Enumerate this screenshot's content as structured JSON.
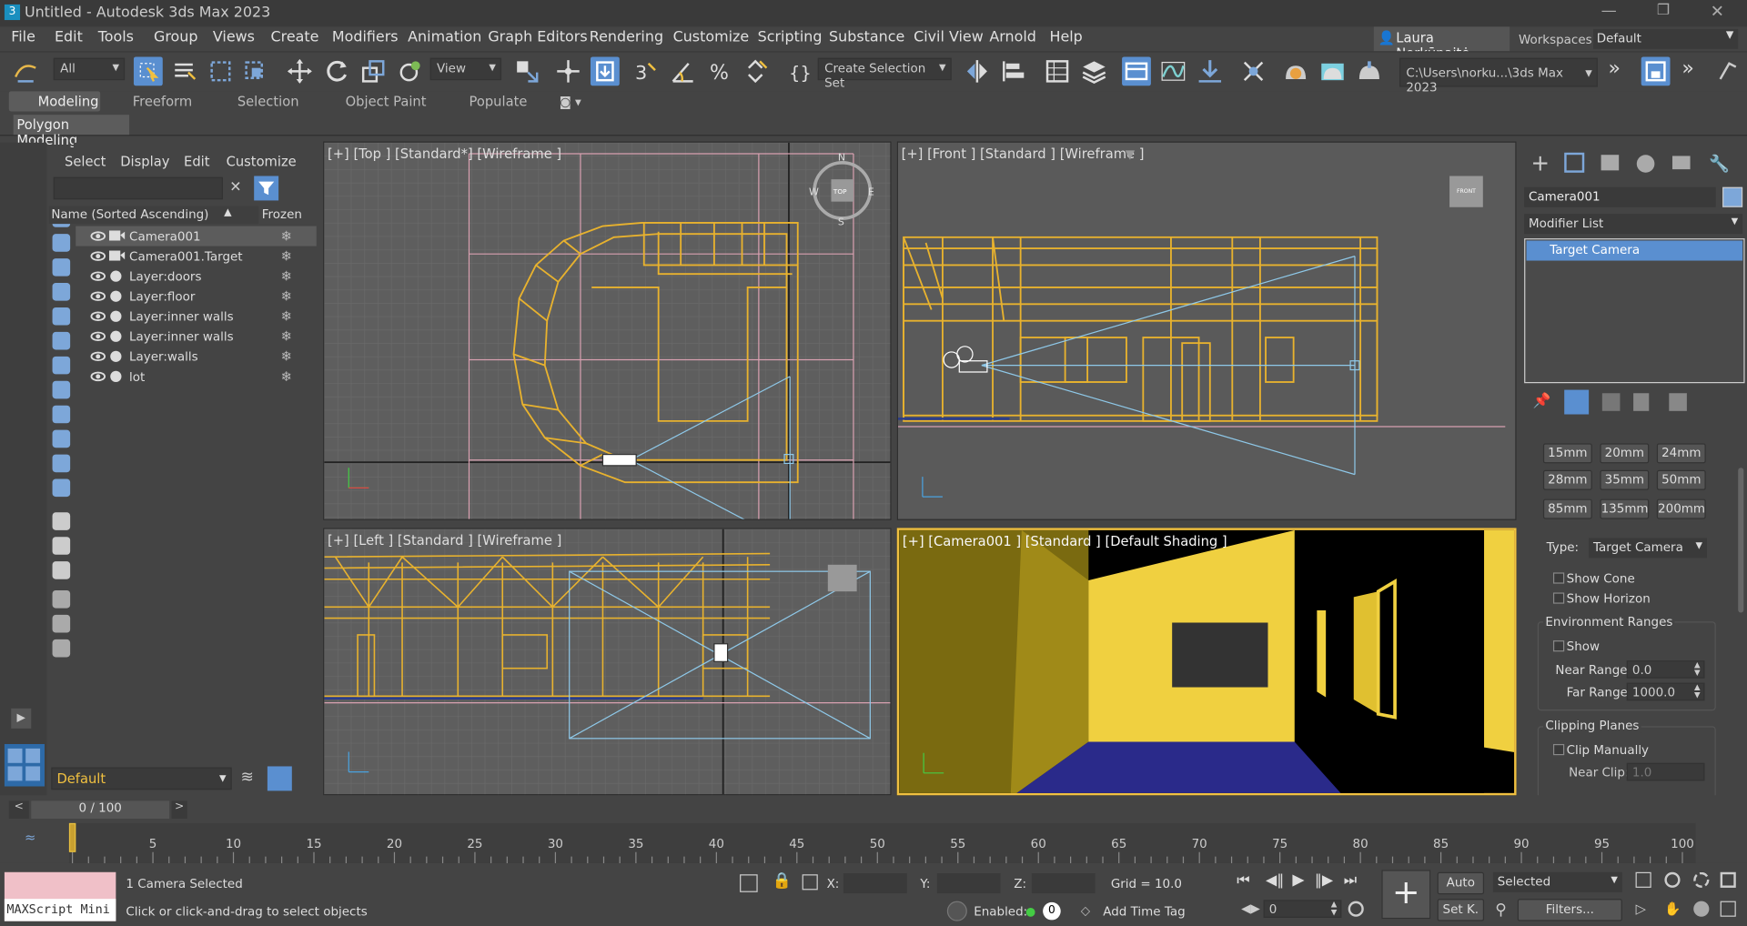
{
  "app": {
    "title": "Untitled - Autodesk 3ds Max 2023",
    "user": "Laura Norkūnaitė",
    "workspaces_label": "Workspaces:",
    "workspace": "Default",
    "path": "C:\\Users\\norku...\\3ds Max 2023"
  },
  "menu": [
    "File",
    "Edit",
    "Tools",
    "Group",
    "Views",
    "Create",
    "Modifiers",
    "Animation",
    "Graph Editors",
    "Rendering",
    "Customize",
    "Scripting",
    "Substance",
    "Civil View",
    "Arnold",
    "Help"
  ],
  "toolbar": {
    "filter": "All",
    "view": "View",
    "selection_set": "Create Selection Set"
  },
  "ribbon": {
    "tabs": [
      "Modeling",
      "Freeform",
      "Selection",
      "Object Paint",
      "Populate"
    ],
    "panel": "Polygon Modeling"
  },
  "scene_explorer": {
    "tabs": [
      "Select",
      "Display",
      "Edit",
      "Customize"
    ],
    "col_name": "Name (Sorted Ascending)",
    "col_frozen": "Frozen",
    "rows": [
      "Camera001",
      "Camera001.Target",
      "Layer:doors",
      "Layer:floor",
      "Layer:inner walls",
      "Layer:inner walls",
      "Layer:walls",
      "lot"
    ],
    "layer": "Default"
  },
  "viewports": {
    "top": "[+] [Top ] [Standard*] [Wireframe ]",
    "front": "[+] [Front ] [Standard ] [Wireframe ]",
    "left": "[+] [Left ] [Standard ] [Wireframe ]",
    "camera": "[+] [Camera001 ] [Standard ] [Default Shading ]",
    "front_cube": "FRONT",
    "compass": {
      "n": "N",
      "s": "S",
      "w": "W",
      "e": "E",
      "top": "TOP"
    }
  },
  "command_panel": {
    "object_name": "Camera001",
    "modifier_list": "Modifier List",
    "stack_item": "Target Camera",
    "lenses": [
      "15mm",
      "20mm",
      "24mm",
      "28mm",
      "35mm",
      "50mm",
      "85mm",
      "135mm",
      "200mm"
    ],
    "type_label": "Type:",
    "type_value": "Target Camera",
    "show_cone": "Show Cone",
    "show_horizon": "Show Horizon",
    "env_ranges": "Environment Ranges",
    "show": "Show",
    "near_range_label": "Near Range:",
    "near_range": "0.0",
    "far_range_label": "Far Range:",
    "far_range": "1000.0",
    "clipping_planes": "Clipping Planes",
    "clip_manually": "Clip Manually",
    "near_clip_label": "Near Clip:",
    "near_clip": "1.0"
  },
  "timeline": {
    "frame": "0 / 100",
    "ticks": [
      "0",
      "5",
      "10",
      "15",
      "20",
      "25",
      "30",
      "35",
      "40",
      "45",
      "50",
      "55",
      "60",
      "65",
      "70",
      "75",
      "80",
      "85",
      "90",
      "95",
      "100"
    ]
  },
  "status": {
    "maxscript": "MAXScript Mini",
    "selected": "1 Camera Selected",
    "prompt": "Click or click-and-drag to select objects",
    "x": "X:",
    "y": "Y:",
    "z": "Z:",
    "grid": "Grid = 10.0",
    "enabled": "Enabled:",
    "enabled_count": "0",
    "add_time_tag": "Add Time Tag",
    "auto": "Auto",
    "set_key": "Set K.",
    "key_filter": "Selected",
    "filters": "Filters...",
    "frame_field": "0"
  }
}
